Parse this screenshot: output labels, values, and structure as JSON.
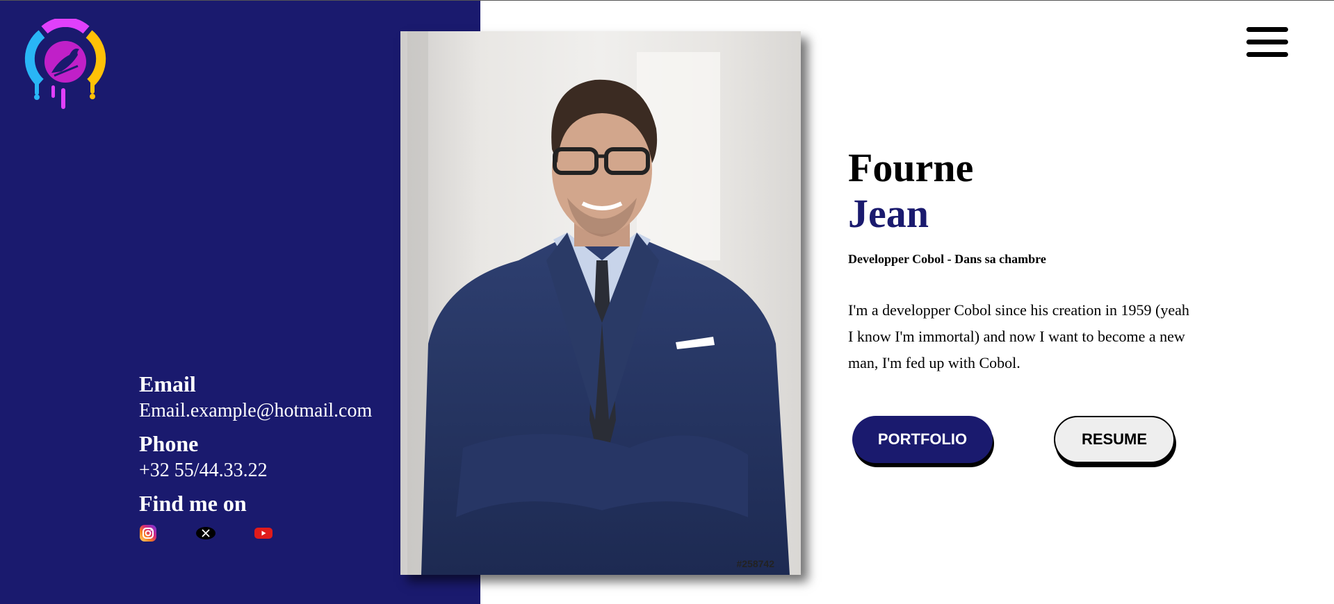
{
  "header": {
    "logo_icon": "bird-drip-logo-icon",
    "menu_icon": "hamburger-menu-icon"
  },
  "contact": {
    "email_heading": "Email",
    "email_value": "Email.example@hotmail.com",
    "phone_heading": "Phone",
    "phone_value": "+32 55/44.33.22",
    "social_heading": "Find me on",
    "socials": [
      "instagram-icon",
      "x-twitter-icon",
      "youtube-icon"
    ]
  },
  "photo": {
    "id_label": "#258742"
  },
  "profile": {
    "last_name": "Fourne",
    "first_name": "Jean",
    "job_title": "Developper Cobol - Dans sa chambre",
    "bio": "I'm a developper Cobol since his creation in 1959 (yeah I know I'm immortal) and now I want to become a new man, I'm fed up with Cobol."
  },
  "actions": {
    "portfolio_label": "PORTFOLIO",
    "resume_label": "RESUME"
  },
  "colors": {
    "accent": "#1a1a6e",
    "background": "#ffffff",
    "button_light": "#eeeeee"
  }
}
